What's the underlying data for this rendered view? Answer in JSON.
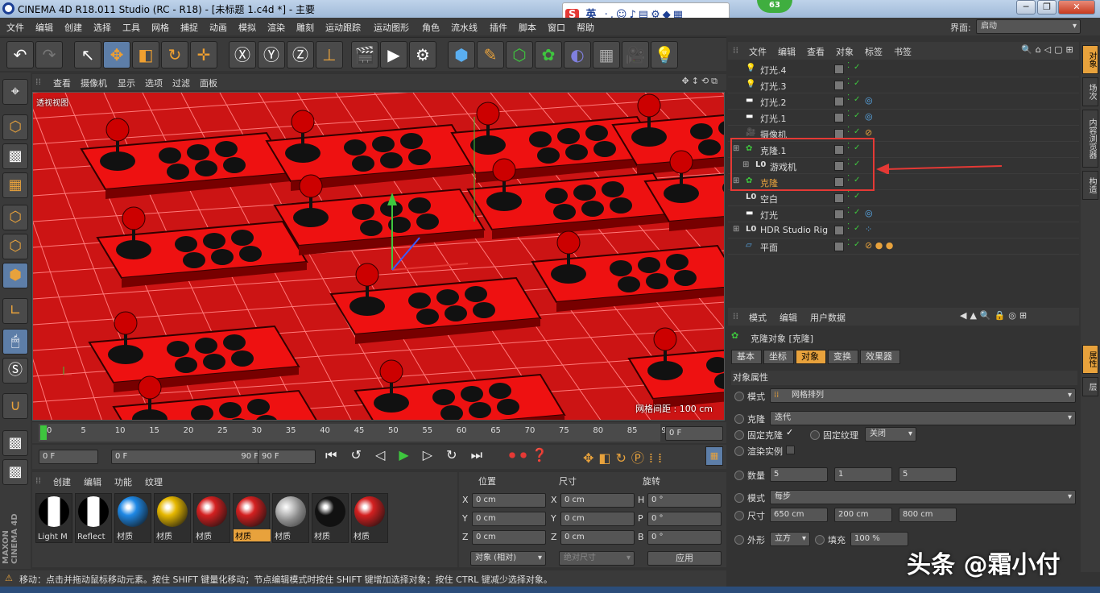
{
  "window": {
    "title": "CINEMA 4D R18.011 Studio (RC - R18) - [未标题 1.c4d *] - 主要",
    "badge": "63"
  },
  "ime": {
    "logo": "S",
    "lang": "英"
  },
  "menu": [
    "文件",
    "编辑",
    "创建",
    "选择",
    "工具",
    "网格",
    "捕捉",
    "动画",
    "模拟",
    "渲染",
    "雕刻",
    "运动跟踪",
    "运动图形",
    "角色",
    "流水线",
    "插件",
    "脚本",
    "窗口",
    "帮助"
  ],
  "layout": {
    "label": "界面:",
    "value": "启动"
  },
  "viewport": {
    "menu": [
      "查看",
      "摄像机",
      "显示",
      "选项",
      "过滤",
      "面板"
    ],
    "label": "透视视图",
    "grid_spacing": "网格间距 : 100 cm",
    "colors": {
      "bg": "#cc1414",
      "grid": "#ff7a7a"
    }
  },
  "timeline": {
    "ticks": [
      "0",
      "5",
      "10",
      "15",
      "20",
      "25",
      "30",
      "35",
      "40",
      "45",
      "50",
      "55",
      "60",
      "65",
      "70",
      "75",
      "80",
      "85",
      "90"
    ],
    "current": "0 F",
    "start": "0 F",
    "range_start": "0 F",
    "range_end": "90 F",
    "end": "90 F"
  },
  "material": {
    "menu": [
      "创建",
      "编辑",
      "功能",
      "纹理"
    ],
    "items": [
      {
        "label": "Light M",
        "color": "#fff",
        "type": "bw"
      },
      {
        "label": "Reflect",
        "color": "#fff",
        "type": "bw"
      },
      {
        "label": "材质",
        "color": "#1e88e5",
        "type": "ball"
      },
      {
        "label": "材质",
        "color": "#e6b800",
        "type": "ball"
      },
      {
        "label": "材质",
        "color": "#d42020",
        "type": "ball"
      },
      {
        "label": "材质",
        "color": "#d42020",
        "type": "ball",
        "selected": true
      },
      {
        "label": "材质",
        "color": "#aaaaaa",
        "type": "chrome"
      },
      {
        "label": "材质",
        "color": "#111111",
        "type": "ball"
      },
      {
        "label": "材质",
        "color": "#d42020",
        "type": "ball"
      }
    ]
  },
  "coords": {
    "headers": [
      "位置",
      "尺寸",
      "旋转"
    ],
    "rows": [
      {
        "a": "X",
        "pos": "0 cm",
        "b": "X",
        "size": "0 cm",
        "c": "H",
        "rot": "0 °"
      },
      {
        "a": "Y",
        "pos": "0 cm",
        "b": "Y",
        "size": "0 cm",
        "c": "P",
        "rot": "0 °"
      },
      {
        "a": "Z",
        "pos": "0 cm",
        "b": "Z",
        "size": "0 cm",
        "c": "B",
        "rot": "0 °"
      }
    ],
    "mode": "对象 (相对)",
    "size_mode": "绝对尺寸",
    "apply": "应用"
  },
  "status": "移动：点击并拖动鼠标移动元素。按住 SHIFT 键量化移动；节点编辑模式时按住 SHIFT 键增加选择对象；按住 CTRL 键减少选择对象。",
  "objects": {
    "menu": [
      "文件",
      "编辑",
      "查看",
      "对象",
      "标签",
      "书签"
    ],
    "rows": [
      {
        "name": "灯光.4",
        "icon": "light",
        "indent": 0
      },
      {
        "name": "灯光.3",
        "icon": "light",
        "indent": 0
      },
      {
        "name": "灯光.2",
        "icon": "area",
        "indent": 0,
        "tag": "target"
      },
      {
        "name": "灯光.1",
        "icon": "area",
        "indent": 0,
        "tag": "target"
      },
      {
        "name": "摄像机",
        "icon": "camera",
        "indent": 0,
        "tag": "protect"
      },
      {
        "name": "克隆.1",
        "icon": "cloner",
        "indent": 0,
        "expand": true
      },
      {
        "name": "游戏机",
        "icon": "null",
        "indent": 1,
        "expand": true
      },
      {
        "name": "克隆",
        "icon": "cloner",
        "indent": 0,
        "expand": true,
        "selected": true
      },
      {
        "name": "空白",
        "icon": "null",
        "indent": 0
      },
      {
        "name": "灯光",
        "icon": "area",
        "indent": 0,
        "tag": "target"
      },
      {
        "name": "HDR Studio Rig",
        "icon": "null",
        "indent": 0,
        "expand": true,
        "tag": "xpresso"
      },
      {
        "name": "平面",
        "icon": "plane",
        "indent": 0,
        "tag": "materials"
      }
    ]
  },
  "attributes": {
    "menu": [
      "模式",
      "编辑",
      "用户数据"
    ],
    "title": "克隆对象 [克隆]",
    "tabs": [
      "基本",
      "坐标",
      "对象",
      "变换",
      "效果器"
    ],
    "active_tab": "对象",
    "section": "对象属性",
    "mode_label": "模式",
    "mode_value": "网格排列",
    "clone_label": "克隆",
    "clone_value": "迭代",
    "fixed_clone": "固定克隆",
    "fixed_texture": "固定纹理",
    "fixed_texture_value": "关闭",
    "render_instances": "渲染实例",
    "count_label": "数量",
    "count": [
      "5",
      "1",
      "5"
    ],
    "mode2_label": "模式",
    "mode2_value": "每步",
    "size_label": "尺寸",
    "size": [
      "650 cm",
      "200 cm",
      "800 cm"
    ],
    "shape_label": "外形",
    "shape_value": "立方",
    "fill_label": "填充",
    "fill_value": "100 %"
  },
  "right_tabs": [
    "对象",
    "场次",
    "内容浏览器",
    "构造",
    "属性",
    "层"
  ],
  "watermark": "头条 @霜小付",
  "accent": "#e8a23c"
}
